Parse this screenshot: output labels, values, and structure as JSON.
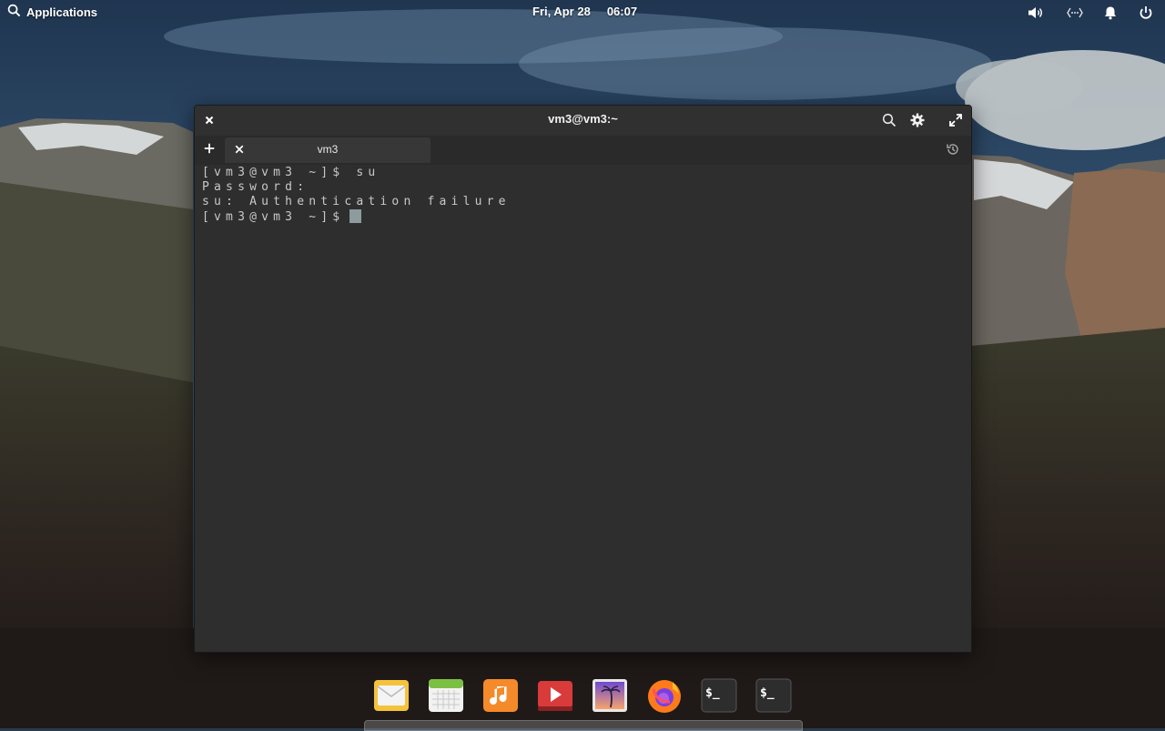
{
  "panel": {
    "applications_label": "Applications",
    "date": "Fri, Apr 28",
    "time": "06:07"
  },
  "window": {
    "title": "vm3@vm3:~",
    "tab_label": "vm3"
  },
  "terminal": {
    "lines": [
      "[vm3@vm3 ~]$ su",
      "Password:",
      "su: Authentication failure",
      "[vm3@vm3 ~]$"
    ]
  },
  "dock": {
    "terminal_icon_text": "$_"
  },
  "colors": {
    "terminal_bg": "#2e2e2e",
    "terminal_fg": "#c8c8c8",
    "cursor": "#8d9a9e"
  }
}
